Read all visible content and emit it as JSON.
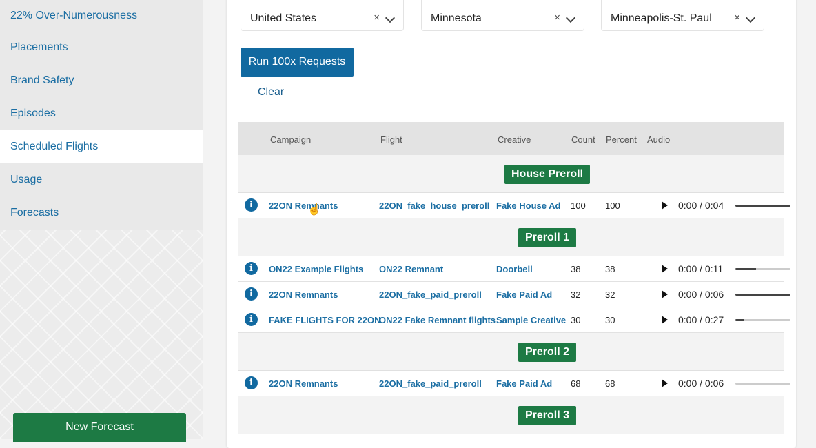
{
  "sidebar": {
    "items": [
      {
        "label": "22% Over-Numerousness",
        "active": false
      },
      {
        "label": "Placements",
        "active": false
      },
      {
        "label": "Brand Safety",
        "active": false
      },
      {
        "label": "Episodes",
        "active": false
      },
      {
        "label": "Scheduled Flights",
        "active": true
      },
      {
        "label": "Usage",
        "active": false
      },
      {
        "label": "Forecasts",
        "active": false
      }
    ],
    "new_forecast_label": "New Forecast"
  },
  "filters": {
    "country": "United States",
    "state": "Minnesota",
    "metro": "Minneapolis-St. Paul",
    "clear_glyph": "×"
  },
  "actions": {
    "run_label": "Run 100x Requests",
    "clear_label": "Clear"
  },
  "table": {
    "headers": {
      "campaign": "Campaign",
      "flight": "Flight",
      "creative": "Creative",
      "count": "Count",
      "percent": "Percent",
      "audio": "Audio"
    },
    "groups": [
      {
        "name": "House Preroll",
        "rows": [
          {
            "campaign": "22ON Remnants",
            "flight": "22ON_fake_house_preroll",
            "creative": "Fake House Ad",
            "count": "100",
            "percent": "100",
            "audio": "0:00 / 0:04",
            "progress": 1.0
          }
        ]
      },
      {
        "name": "Preroll 1",
        "rows": [
          {
            "campaign": "ON22 Example Flights",
            "flight": "ON22 Remnant",
            "creative": "Doorbell",
            "count": "38",
            "percent": "38",
            "audio": "0:00 / 0:11",
            "progress": 0.38
          },
          {
            "campaign": "22ON Remnants",
            "flight": "22ON_fake_paid_preroll",
            "creative": "Fake Paid Ad",
            "count": "32",
            "percent": "32",
            "audio": "0:00 / 0:06",
            "progress": 1.0
          },
          {
            "campaign": "FAKE FLIGHTS FOR 22ON",
            "flight": "ON22 Fake Remnant flights",
            "creative": "Sample Creative",
            "count": "30",
            "percent": "30",
            "audio": "0:00 / 0:27",
            "progress": 0.15
          }
        ]
      },
      {
        "name": "Preroll 2",
        "rows": [
          {
            "campaign": "22ON Remnants",
            "flight": "22ON_fake_paid_preroll",
            "creative": "Fake Paid Ad",
            "count": "68",
            "percent": "68",
            "audio": "0:00 / 0:06",
            "progress": 0.0
          }
        ]
      },
      {
        "name": "Preroll 3",
        "rows": []
      }
    ]
  },
  "icons": {
    "info": "info-icon",
    "play": "play-icon",
    "clear": "clear-icon",
    "chevron": "chevron-down-icon"
  },
  "colors": {
    "link": "#1b6ea3",
    "primary": "#1169a0",
    "badge": "#1d7a44"
  }
}
